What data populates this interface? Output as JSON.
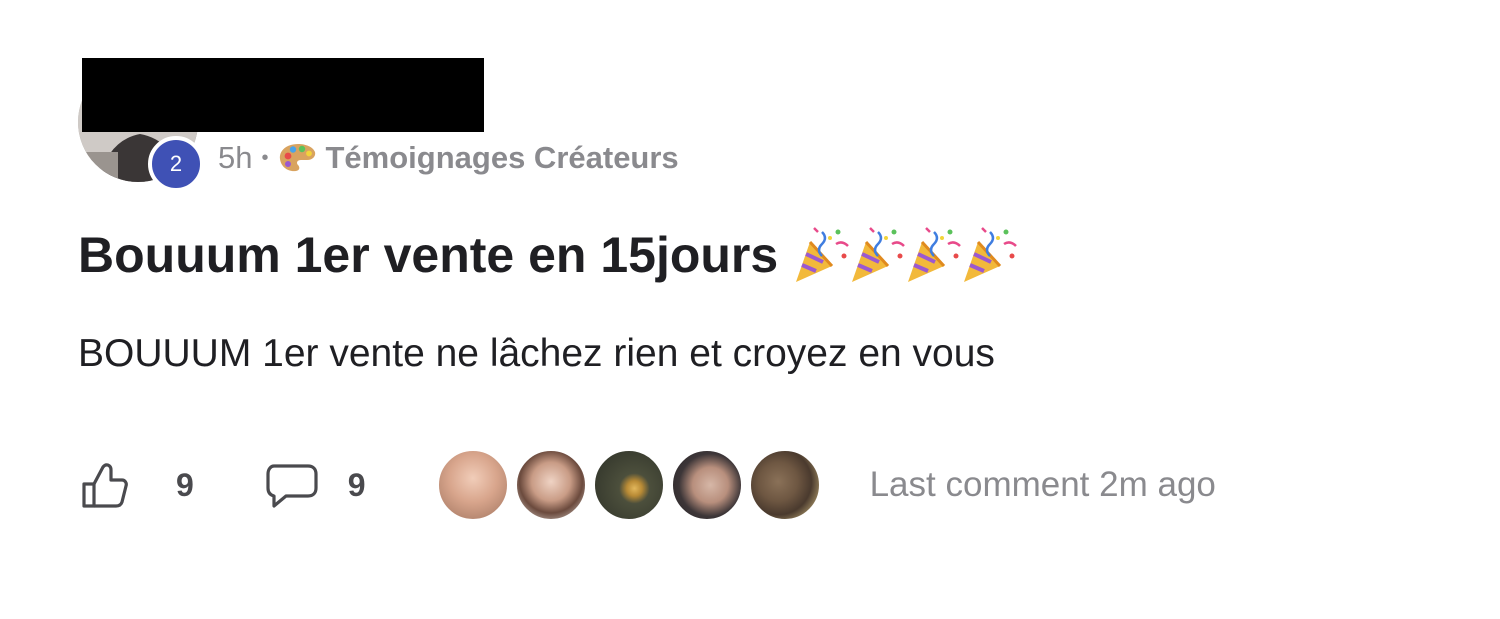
{
  "author": {
    "level": "2"
  },
  "meta": {
    "time": "5h",
    "separator": "•",
    "space_icon": "artist-palette-icon",
    "space_name": "Témoignages Créateurs"
  },
  "post": {
    "title": "Bouuum 1er vente en 15jours",
    "title_emoji": "party-popper-icon",
    "title_emoji_count": 4,
    "body": "BOUUUM 1er vente ne lâchez rien et croyez en vous"
  },
  "footer": {
    "like_icon": "thumbs-up-icon",
    "like_count": "9",
    "comment_icon": "comment-bubble-icon",
    "comment_count": "9",
    "last_comment": "Last comment 2m ago"
  },
  "colors": {
    "badge": "#3f51b5",
    "muted_text": "#8a8a8e",
    "primary_text": "#1f1f23"
  }
}
